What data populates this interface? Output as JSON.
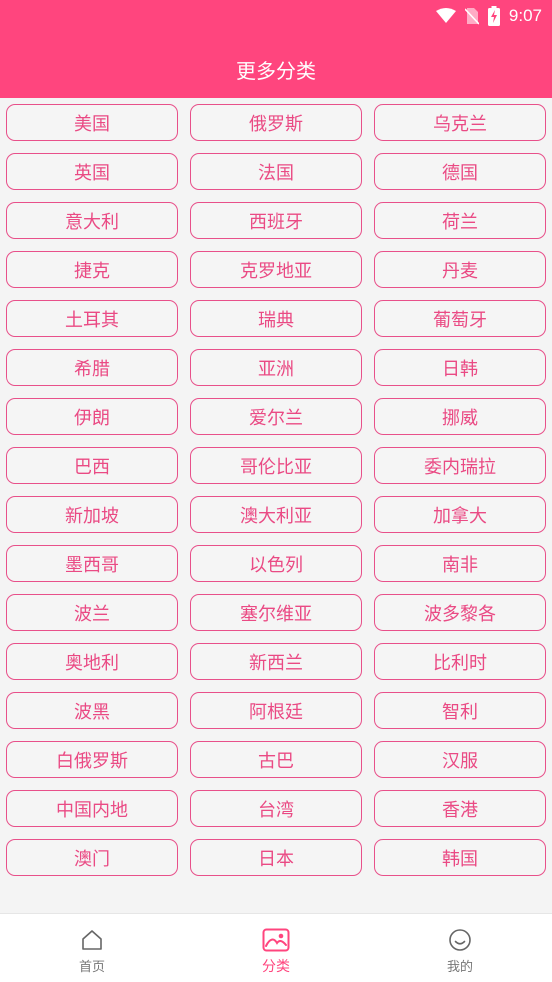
{
  "status_bar": {
    "time": "9:07"
  },
  "header": {
    "title": "更多分类"
  },
  "categories": [
    "美国",
    "俄罗斯",
    "乌克兰",
    "英国",
    "法国",
    "德国",
    "意大利",
    "西班牙",
    "荷兰",
    "捷克",
    "克罗地亚",
    "丹麦",
    "土耳其",
    "瑞典",
    "葡萄牙",
    "希腊",
    "亚洲",
    "日韩",
    "伊朗",
    "爱尔兰",
    "挪威",
    "巴西",
    "哥伦比亚",
    "委内瑞拉",
    "新加坡",
    "澳大利亚",
    "加拿大",
    "墨西哥",
    "以色列",
    "南非",
    "波兰",
    "塞尔维亚",
    "波多黎各",
    "奥地利",
    "新西兰",
    "比利时",
    "波黑",
    "阿根廷",
    "智利",
    "白俄罗斯",
    "古巴",
    "汉服",
    "中国内地",
    "台湾",
    "香港",
    "澳门",
    "日本",
    "韩国"
  ],
  "tabs": [
    {
      "label": "首页",
      "icon": "home-icon"
    },
    {
      "label": "分类",
      "icon": "image-category-icon"
    },
    {
      "label": "我的",
      "icon": "smiley-icon"
    }
  ],
  "colors": {
    "accent": "#ff457e",
    "button_border": "#e8508a",
    "button_text": "#ea4a84"
  }
}
